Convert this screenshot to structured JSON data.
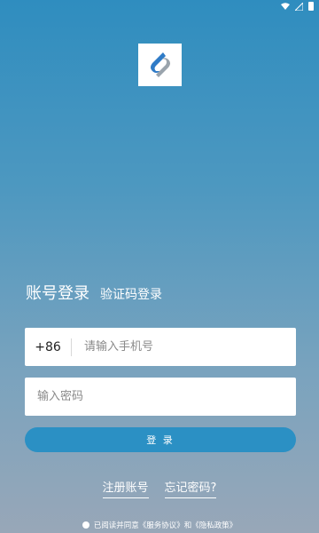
{
  "status_bar": {
    "icons": [
      "wifi-icon",
      "signal-icon",
      "battery-icon"
    ]
  },
  "logo": {
    "icon": "app-logo-icon",
    "colors": [
      "#2f7bc7",
      "#9aa4ad"
    ]
  },
  "tabs": {
    "account_login": "账号登录",
    "code_login": "验证码登录"
  },
  "phone": {
    "country_code": "+86",
    "placeholder": "请输入手机号"
  },
  "password": {
    "placeholder": "输入密码"
  },
  "login_button": {
    "label": "登 录"
  },
  "links": {
    "register": "注册账号",
    "forgot": "忘记密码?"
  },
  "agreement": {
    "text": "已阅读并同意《服务协议》和《隐私政策》"
  },
  "colors": {
    "gradient_top": "#2f8dbf",
    "gradient_bottom": "#98a7b8",
    "button": "#2b90c4"
  }
}
